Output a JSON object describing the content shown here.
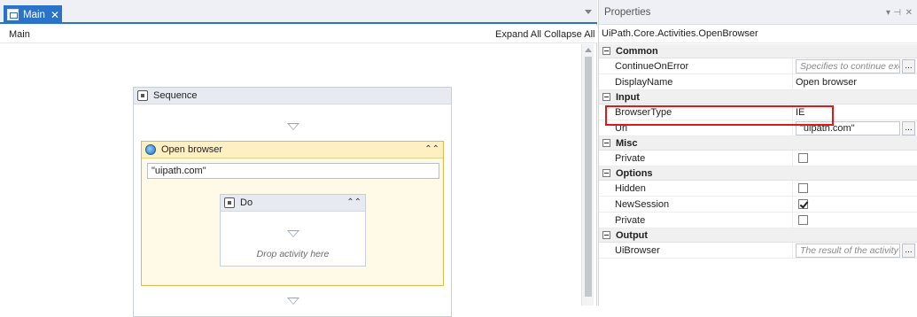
{
  "designer": {
    "tab_label": "Main",
    "breadcrumb": "Main",
    "expand_all": "Expand All",
    "collapse_all": "Collapse All",
    "sequence": {
      "title": "Sequence",
      "open_browser": {
        "title": "Open browser",
        "url_value": "\"uipath.com\"",
        "do": {
          "title": "Do",
          "drop_hint": "Drop activity here"
        }
      }
    }
  },
  "properties": {
    "panel_title": "Properties",
    "activity_type": "UiPath.Core.Activities.OpenBrowser",
    "categories": {
      "common": "Common",
      "input": "Input",
      "misc": "Misc",
      "options": "Options",
      "output": "Output"
    },
    "rows": {
      "continue_on_error": {
        "label": "ContinueOnError",
        "placeholder": "Specifies to continue executi"
      },
      "display_name": {
        "label": "DisplayName",
        "value": "Open browser"
      },
      "browser_type": {
        "label": "BrowserType",
        "value": "IE"
      },
      "url": {
        "label": "Url",
        "value": "\"uipath.com\""
      },
      "misc_private": {
        "label": "Private",
        "checked": false
      },
      "hidden": {
        "label": "Hidden",
        "checked": false
      },
      "new_session": {
        "label": "NewSession",
        "checked": true
      },
      "options_private": {
        "label": "Private",
        "checked": false
      },
      "ui_browser": {
        "label": "UiBrowser",
        "placeholder": "The result of the activity a..."
      }
    },
    "ellipsis": "..."
  },
  "colors": {
    "tab_accent": "#2b73c9",
    "activity_header": "#fff0c4",
    "highlight": "#e01818"
  }
}
